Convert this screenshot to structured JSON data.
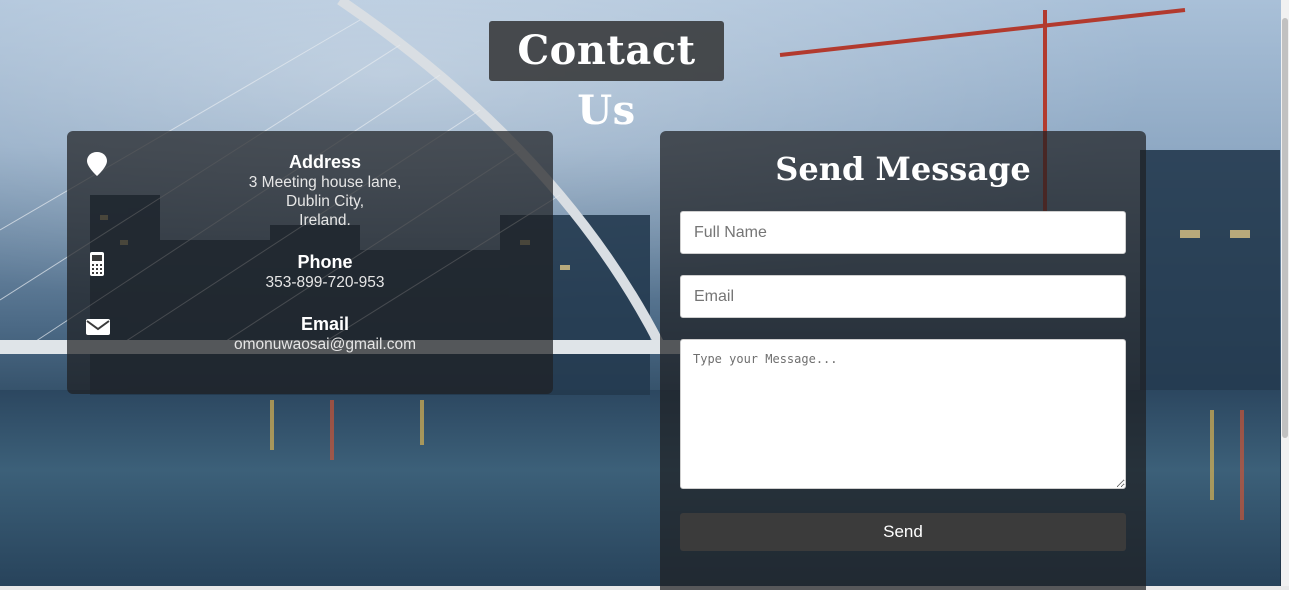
{
  "page": {
    "title": "Contact Us"
  },
  "info": {
    "address": {
      "icon": "map-pin-icon",
      "heading": "Address",
      "lines": [
        "3 Meeting house lane,",
        "Dublin City,",
        "Ireland."
      ]
    },
    "phone": {
      "icon": "mobile-phone-icon",
      "heading": "Phone",
      "value": "353-899-720-953"
    },
    "email": {
      "icon": "envelope-icon",
      "heading": "Email",
      "value": "omonuwaosai@gmail.com"
    }
  },
  "form": {
    "title": "Send Message",
    "name_placeholder": "Full Name",
    "email_placeholder": "Email",
    "message_placeholder": "Type your Message...",
    "send_label": "Send"
  },
  "colors": {
    "panel": "#1e2022",
    "button": "#3b3b3b",
    "text": "#ffffff"
  }
}
